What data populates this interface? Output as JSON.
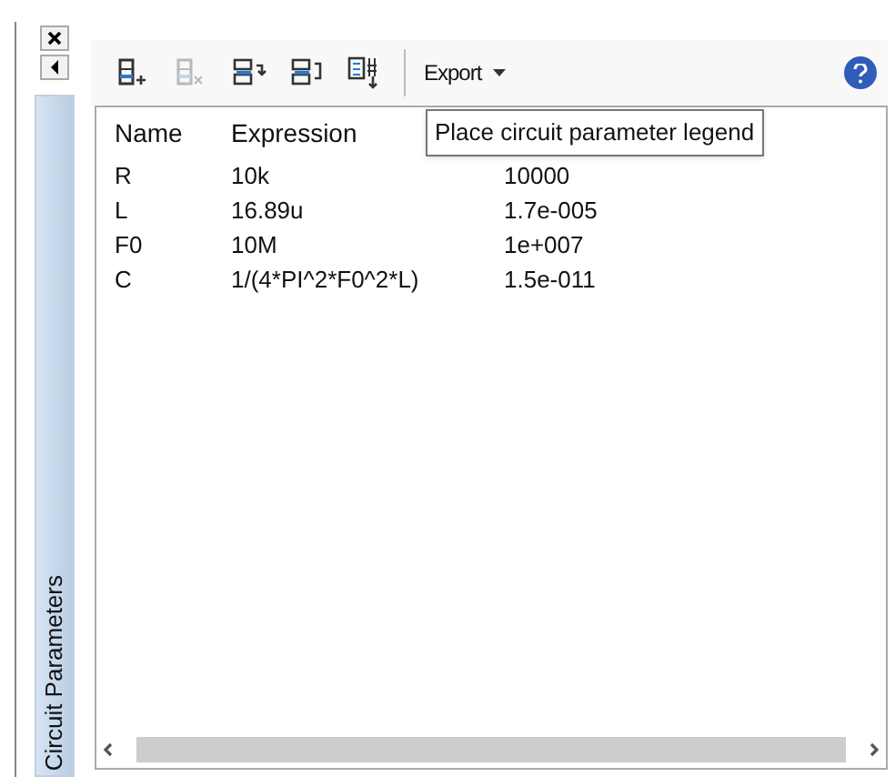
{
  "side_tab": {
    "title": "Circuit Parameters"
  },
  "toolbar": {
    "buttons": [
      {
        "kind": "add",
        "disabled": false
      },
      {
        "kind": "delete",
        "disabled": true
      },
      {
        "kind": "import",
        "disabled": false
      },
      {
        "kind": "export",
        "disabled": false
      },
      {
        "kind": "legend",
        "disabled": false
      }
    ],
    "export_menu": "Export"
  },
  "tooltip": "Place circuit parameter legend",
  "table": {
    "columns": [
      "Name",
      "Expression"
    ],
    "rows": [
      {
        "name": "R",
        "expression": "10k",
        "value": "10000"
      },
      {
        "name": "L",
        "expression": "16.89u",
        "value": "1.7e-005"
      },
      {
        "name": "F0",
        "expression": "10M",
        "value": "1e+007"
      },
      {
        "name": "C",
        "expression": "1/(4*PI^2*F0^2*L)",
        "value": "1.5e-011"
      }
    ]
  }
}
